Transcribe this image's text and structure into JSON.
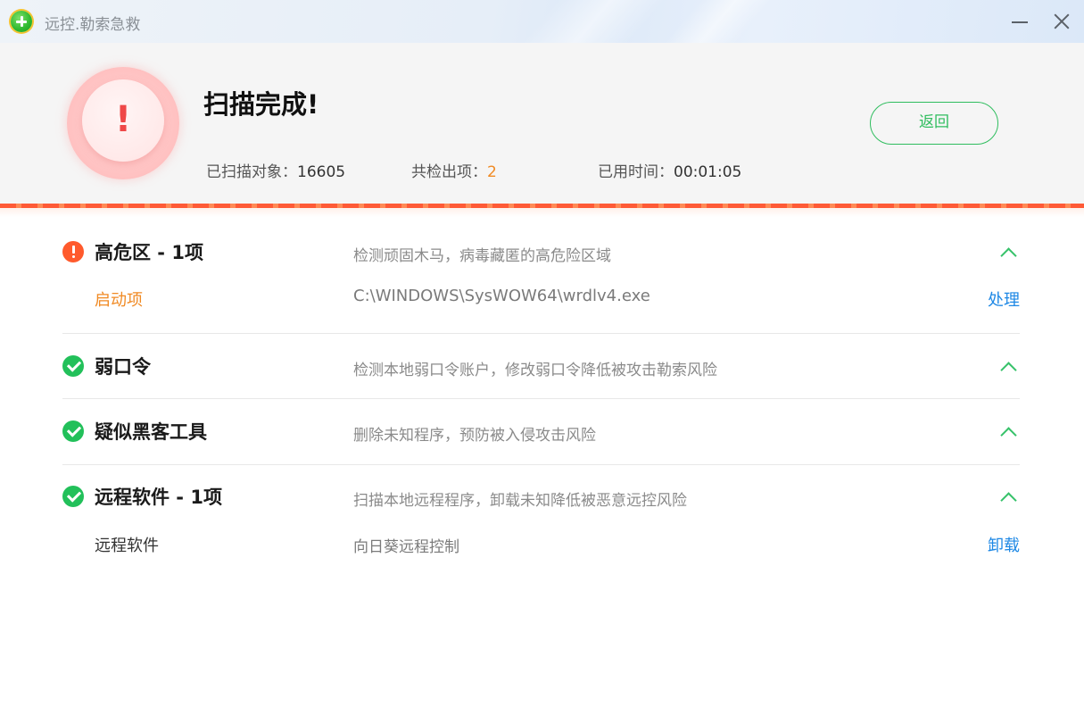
{
  "app": {
    "title": "远控.勒索急救"
  },
  "header": {
    "title": "扫描完成!",
    "stats": {
      "objects_label": "已扫描对象：",
      "objects_value": "16605",
      "found_label": "共检出项：",
      "found_value": "2",
      "time_label": "已用时间：",
      "time_value": "00:01:05"
    },
    "back_button": "返回",
    "alert_mark": "!"
  },
  "sections": [
    {
      "title": "高危区 -  1项",
      "description": "检测顽固木马，病毒藏匿的高危险区域",
      "status": "danger",
      "items": [
        {
          "label": "启动项",
          "detail": "C:\\WINDOWS\\SysWOW64\\wrdlv4.exe",
          "action": "处理"
        }
      ]
    },
    {
      "title": "弱口令",
      "description": "检测本地弱口令账户，修改弱口令降低被攻击勒索风险",
      "status": "ok",
      "items": []
    },
    {
      "title": "疑似黑客工具",
      "description": "删除未知程序，预防被入侵攻击风险",
      "status": "ok",
      "items": []
    },
    {
      "title": "远程软件 -  1项",
      "description": "扫描本地远程程序，卸载未知降低被恶意远控风险",
      "status": "ok",
      "items": [
        {
          "label": "远程软件",
          "detail": "向日葵远程控制",
          "action": "卸载"
        }
      ]
    }
  ],
  "colors": {
    "accent_green": "#2fbd5e",
    "danger_orange": "#ff5a2c",
    "warning_orange": "#f08a24",
    "link_blue": "#1e88e5"
  },
  "icons": {
    "app": "app-logo-icon",
    "alert": "alert-exclamation-icon",
    "danger": "warning-circle-icon",
    "ok": "check-circle-icon",
    "collapse": "chevron-up-icon",
    "minimize": "minimize-icon",
    "close": "close-icon"
  }
}
